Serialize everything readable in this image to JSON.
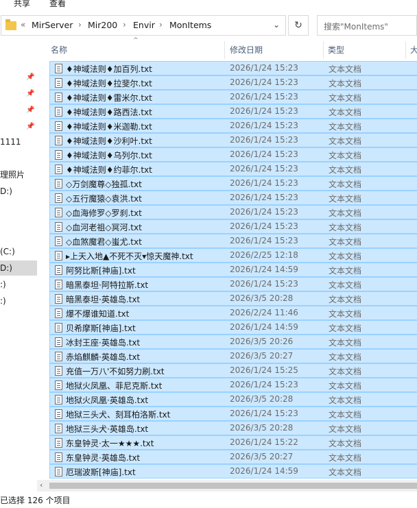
{
  "ribbon": {
    "share": "共享",
    "view": "查看"
  },
  "address": {
    "overflow": "«",
    "crumbs": [
      "MirServer",
      "Mir200",
      "Envir",
      "MonItems"
    ],
    "dropdown_icon": "chevron-down-icon",
    "refresh_icon": "refresh-icon"
  },
  "search": {
    "placeholder": "搜索\"MonItems\""
  },
  "nav": {
    "items": [
      "1111",
      "理照片",
      "D:)",
      "(C:)",
      "D:)",
      ":)",
      ":)"
    ],
    "selected_index": 4
  },
  "columns": {
    "name": "名称",
    "date": "修改日期",
    "type": "类型",
    "size": "大"
  },
  "files": [
    {
      "name": "♦神域法则♦加百列.txt",
      "date": "2026/1/24 15:23",
      "type": "文本文档"
    },
    {
      "name": "♦神域法则♦拉斐尔.txt",
      "date": "2026/1/24 15:23",
      "type": "文本文档"
    },
    {
      "name": "♦神域法则♦雷米尔.txt",
      "date": "2026/1/24 15:23",
      "type": "文本文档"
    },
    {
      "name": "♦神域法则♦路西法.txt",
      "date": "2026/1/24 15:23",
      "type": "文本文档"
    },
    {
      "name": "♦神域法则♦米迦勒.txt",
      "date": "2026/1/24 15:23",
      "type": "文本文档"
    },
    {
      "name": "♦神域法则♦沙利叶.txt",
      "date": "2026/1/24 15:23",
      "type": "文本文档"
    },
    {
      "name": "♦神域法则♦乌列尔.txt",
      "date": "2026/1/24 15:23",
      "type": "文本文档"
    },
    {
      "name": "♦神域法则♦约菲尔.txt",
      "date": "2026/1/24 15:23",
      "type": "文本文档"
    },
    {
      "name": "◇万剑魔尊◇独孤.txt",
      "date": "2026/1/24 15:23",
      "type": "文本文档"
    },
    {
      "name": "◇五行魔猿◇袁洪.txt",
      "date": "2026/1/24 15:23",
      "type": "文本文档"
    },
    {
      "name": "◇血海修罗◇罗刹.txt",
      "date": "2026/1/24 15:23",
      "type": "文本文档"
    },
    {
      "name": "◇血河老祖◇冥河.txt",
      "date": "2026/1/24 15:23",
      "type": "文本文档"
    },
    {
      "name": "◇血煞魔君◇蚩尤.txt",
      "date": "2026/1/24 15:23",
      "type": "文本文档"
    },
    {
      "name": "▸上天入地▲不死不灭▾惊天魔神.txt",
      "date": "2026/2/25 12:18",
      "type": "文本文档"
    },
    {
      "name": "阿努比斯[神庙].txt",
      "date": "2026/1/24 14:59",
      "type": "文本文档"
    },
    {
      "name": "暗黑泰坦·阿特拉斯.txt",
      "date": "2026/1/24 15:23",
      "type": "文本文档"
    },
    {
      "name": "暗黑泰坦·英雄岛.txt",
      "date": "2026/3/5 20:28",
      "type": "文本文档"
    },
    {
      "name": "爆不爆谁知道.txt",
      "date": "2026/2/24 11:46",
      "type": "文本文档"
    },
    {
      "name": "贝希摩斯[神庙].txt",
      "date": "2026/1/24 14:59",
      "type": "文本文档"
    },
    {
      "name": "冰封王座·英雄岛.txt",
      "date": "2026/3/5 20:26",
      "type": "文本文档"
    },
    {
      "name": "赤焰麒麟·英雄岛.txt",
      "date": "2026/3/5 20:27",
      "type": "文本文档"
    },
    {
      "name": "充值一万八'不如努力刷.txt",
      "date": "2026/1/24 15:25",
      "type": "文本文档"
    },
    {
      "name": "地狱火凤凰、菲尼克斯.txt",
      "date": "2026/1/24 15:23",
      "type": "文本文档"
    },
    {
      "name": "地狱火凤凰·英雄岛.txt",
      "date": "2026/3/5 20:28",
      "type": "文本文档"
    },
    {
      "name": "地狱三头犬、刻耳柏洛斯.txt",
      "date": "2026/1/24 15:23",
      "type": "文本文档"
    },
    {
      "name": "地狱三头犬·英雄岛.txt",
      "date": "2026/3/5 20:28",
      "type": "文本文档"
    },
    {
      "name": "东皇钟灵·太一★★★.txt",
      "date": "2026/1/24 15:22",
      "type": "文本文档"
    },
    {
      "name": "东皇钟灵·英雄岛.txt",
      "date": "2026/3/5 20:27",
      "type": "文本文档"
    },
    {
      "name": "厄瑞波斯[神庙].txt",
      "date": "2026/1/24 14:59",
      "type": "文本文档"
    }
  ],
  "status": {
    "text": "已选择 126 个项目"
  }
}
